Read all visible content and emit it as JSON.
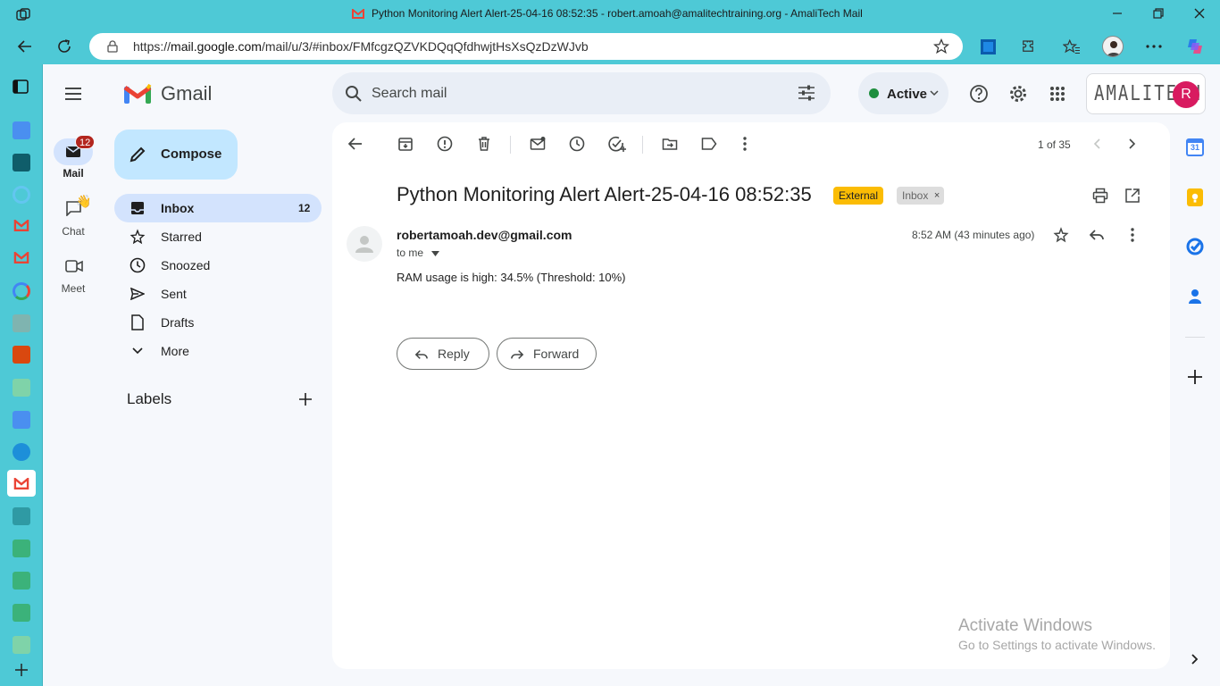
{
  "browser": {
    "window_title": "Python Monitoring Alert Alert-25-04-16 08:52:35 - robert.amoah@amalitechtraining.org - AmaliTech Mail",
    "url_prefix": "https://",
    "url_host": "mail.google.com",
    "url_path": "/mail/u/3/#inbox/FMfcgzQZVKDQqQfdhwjtHsXsQzDzWJvb"
  },
  "gmail": {
    "brand": "Gmail",
    "search_placeholder": "Search mail",
    "status": "Active",
    "org_logo": "AMALITECH",
    "avatar_initial": "R"
  },
  "rail": {
    "mail_label": "Mail",
    "mail_badge": "12",
    "chat_label": "Chat",
    "meet_label": "Meet"
  },
  "nav": {
    "compose": "Compose",
    "items": [
      {
        "label": "Inbox",
        "count": "12",
        "icon": "inbox-icon"
      },
      {
        "label": "Starred",
        "icon": "star-icon"
      },
      {
        "label": "Snoozed",
        "icon": "clock-icon"
      },
      {
        "label": "Sent",
        "icon": "send-icon"
      },
      {
        "label": "Drafts",
        "icon": "draft-icon"
      },
      {
        "label": "More",
        "icon": "chevron-down-icon"
      }
    ],
    "labels_heading": "Labels"
  },
  "toolbar": {
    "pagination": "1 of 35"
  },
  "message": {
    "subject": "Python Monitoring Alert Alert-25-04-16 08:52:35",
    "chip_external": "External",
    "chip_inbox": "Inbox",
    "sender": "robertamoah.dev@gmail.com",
    "recipient": "to me",
    "time": "8:52 AM (43 minutes ago)",
    "body": "RAM usage is high: 34.5% (Threshold: 10%)",
    "reply_label": "Reply",
    "forward_label": "Forward"
  },
  "watermark": {
    "line1": "Activate Windows",
    "line2": "Go to Settings to activate Windows."
  },
  "colors": {
    "chrome": "#4ec9d6",
    "gmail_bg": "#f6f8fc",
    "compose_bg": "#c2e7ff",
    "selected_nav": "#d3e3fd",
    "external_chip": "#fbbc04",
    "inbox_chip": "#dddddd",
    "avatar": "#d81b60",
    "status_dot": "#1e8e3e"
  }
}
